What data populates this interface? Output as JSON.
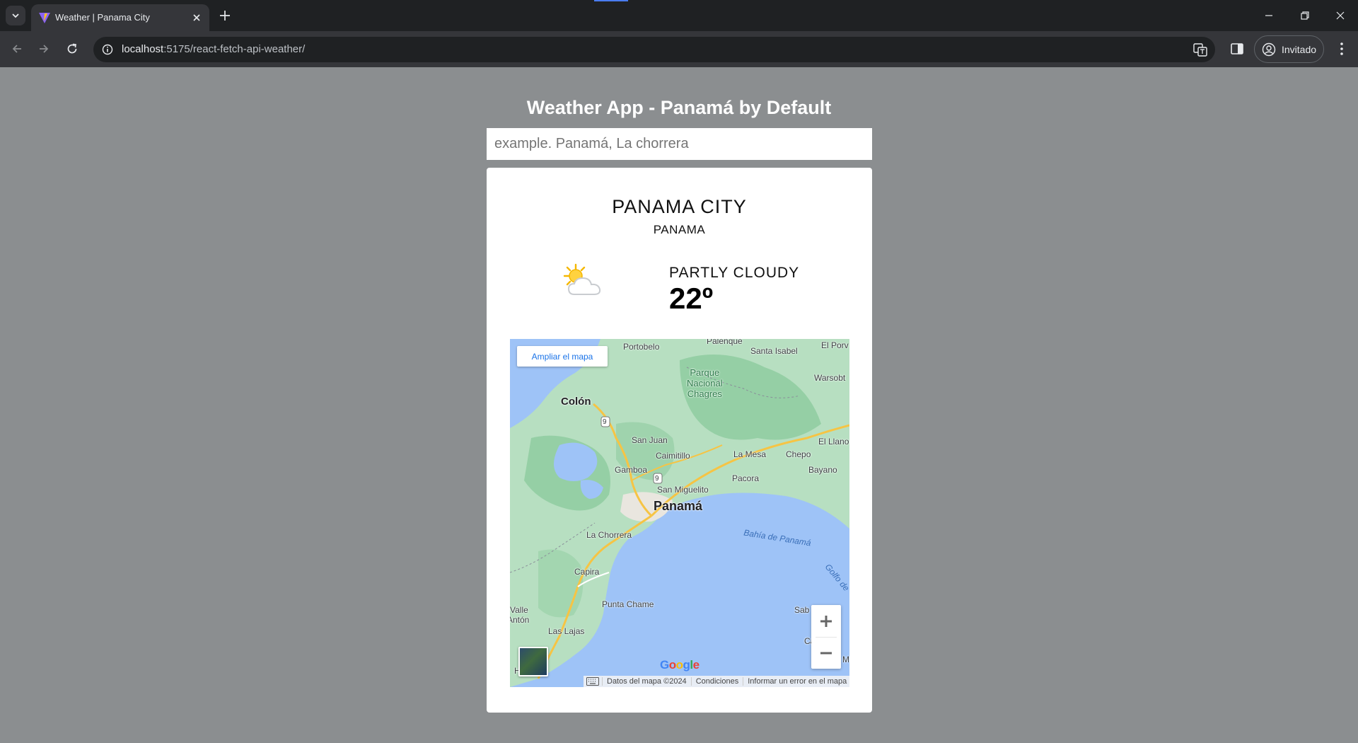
{
  "browser": {
    "tab_title": "Weather | Panama City",
    "url_host": "localhost",
    "url_path": ":5175/react-fetch-api-weather/",
    "profile_label": "Invitado"
  },
  "page": {
    "title": "Weather App - Panamá by Default",
    "search_placeholder": "example. Panamá, La chorrera"
  },
  "weather": {
    "city": "PANAMA CITY",
    "country": "PANAMA",
    "condition": "PARTLY CLOUDY",
    "temperature": "22º",
    "icon": "partly-cloudy-icon"
  },
  "map": {
    "enlarge_label": "Ampliar el mapa",
    "places": {
      "panama": "Panamá",
      "colon": "Colón",
      "portobelo": "Portobelo",
      "palenque": "Palenque",
      "santa_isabel": "Santa Isabel",
      "el_porv": "El Porv",
      "warsobt": "Warsobt",
      "park": "Parque\nNacional\nChagres",
      "san_juan": "San Juan",
      "caimitillo": "Caimitillo",
      "la_mesa": "La Mesa",
      "chepo": "Chepo",
      "el_llano": "El Llano",
      "bayano": "Bayano",
      "gamboa": "Gamboa",
      "pacora": "Pacora",
      "san_miguelito": "San Miguelito",
      "la_chorrera": "La Chorrera",
      "bahia": "Bahía de Panamá",
      "golfo": "Golfo de",
      "capira": "Capira",
      "punta_chame": "Punta Chame",
      "valle": "Valle",
      "anton": "Antón",
      "las_lajas": "Las Lajas",
      "sab": "Sab",
      "ca": "Ca",
      "m": "M",
      "h": "H",
      "route_9": "9"
    },
    "google": "Google",
    "attribution": {
      "data": "Datos del mapa ©2024",
      "terms": "Condiciones",
      "report": "Informar un error en el mapa"
    }
  },
  "colors": {
    "page_bg": "#8b8e90",
    "card_bg": "#ffffff",
    "map_water": "#9ec3f7",
    "map_land": "#b7dfc1",
    "link_blue": "#1a73e8"
  }
}
